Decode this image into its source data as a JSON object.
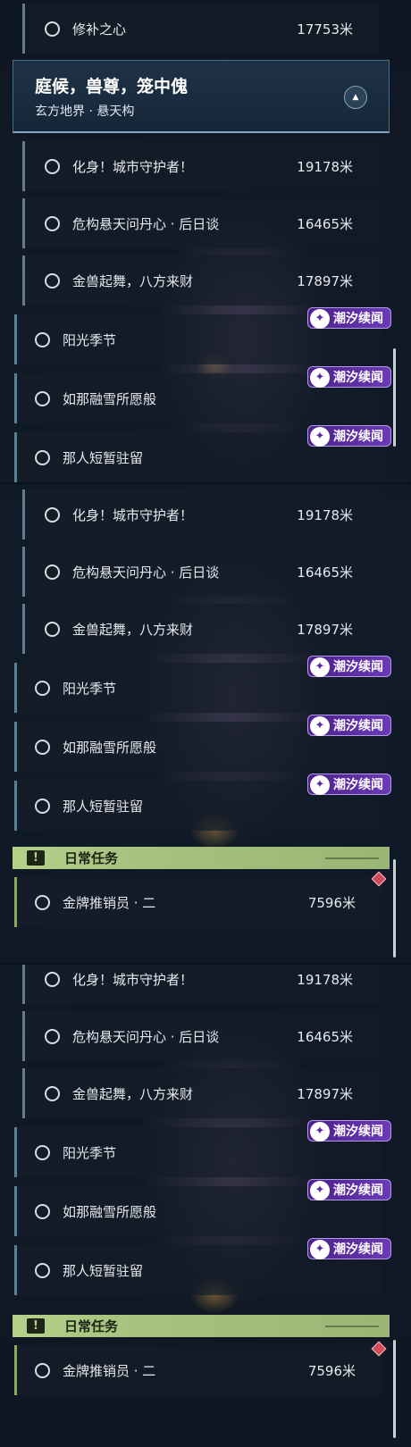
{
  "panel1": {
    "top_item": {
      "name": "修补之心",
      "distance": "17753米"
    },
    "header": {
      "title": "庭候，兽尊，笼中傀",
      "subtitle": "玄方地界 · 悬天构",
      "collapse_icon": "chevron-up-icon"
    },
    "main_items": [
      {
        "name": "化身！城市守护者！",
        "distance": "19178米"
      },
      {
        "name": "危构悬天问丹心 · 后日谈",
        "distance": "16465米"
      },
      {
        "name": "金兽起舞，八方来财",
        "distance": "17897米"
      }
    ],
    "side_items": [
      {
        "name": "阳光季节",
        "badge": "潮汐续闻"
      },
      {
        "name": "如那融雪所愿般",
        "badge": "潮汐续闻"
      },
      {
        "name": "那人短暂驻留",
        "badge": "潮汐续闻"
      }
    ]
  },
  "panel2": {
    "main_items": [
      {
        "name": "化身！城市守护者！",
        "distance": "19178米"
      },
      {
        "name": "危构悬天问丹心 · 后日谈",
        "distance": "16465米"
      },
      {
        "name": "金兽起舞，八方来财",
        "distance": "17897米"
      }
    ],
    "side_items": [
      {
        "name": "阳光季节",
        "badge": "潮汐续闻"
      },
      {
        "name": "如那融雪所愿般",
        "badge": "潮汐续闻"
      },
      {
        "name": "那人短暂驻留",
        "badge": "潮汐续闻"
      }
    ],
    "daily": {
      "title": "日常任务",
      "item": {
        "name": "金牌推销员 · 二",
        "distance": "7596米"
      }
    }
  },
  "panel3": {
    "main_items": [
      {
        "name": "化身！城市守护者！",
        "distance": "19178米"
      },
      {
        "name": "危构悬天问丹心 · 后日谈",
        "distance": "16465米"
      },
      {
        "name": "金兽起舞，八方来财",
        "distance": "17897米"
      }
    ],
    "side_items": [
      {
        "name": "阳光季节",
        "badge": "潮汐续闻"
      },
      {
        "name": "如那融雪所愿般",
        "badge": "潮汐续闻"
      },
      {
        "name": "那人短暂驻留",
        "badge": "潮汐续闻"
      }
    ],
    "daily": {
      "title": "日常任务",
      "item": {
        "name": "金牌推销员 · 二",
        "distance": "7596米"
      }
    }
  },
  "colors": {
    "accent_purple": "#6a3bb4",
    "daily_green": "#b6d08a",
    "quest_border": "#5e7f92",
    "marker_red": "#d24b58"
  }
}
